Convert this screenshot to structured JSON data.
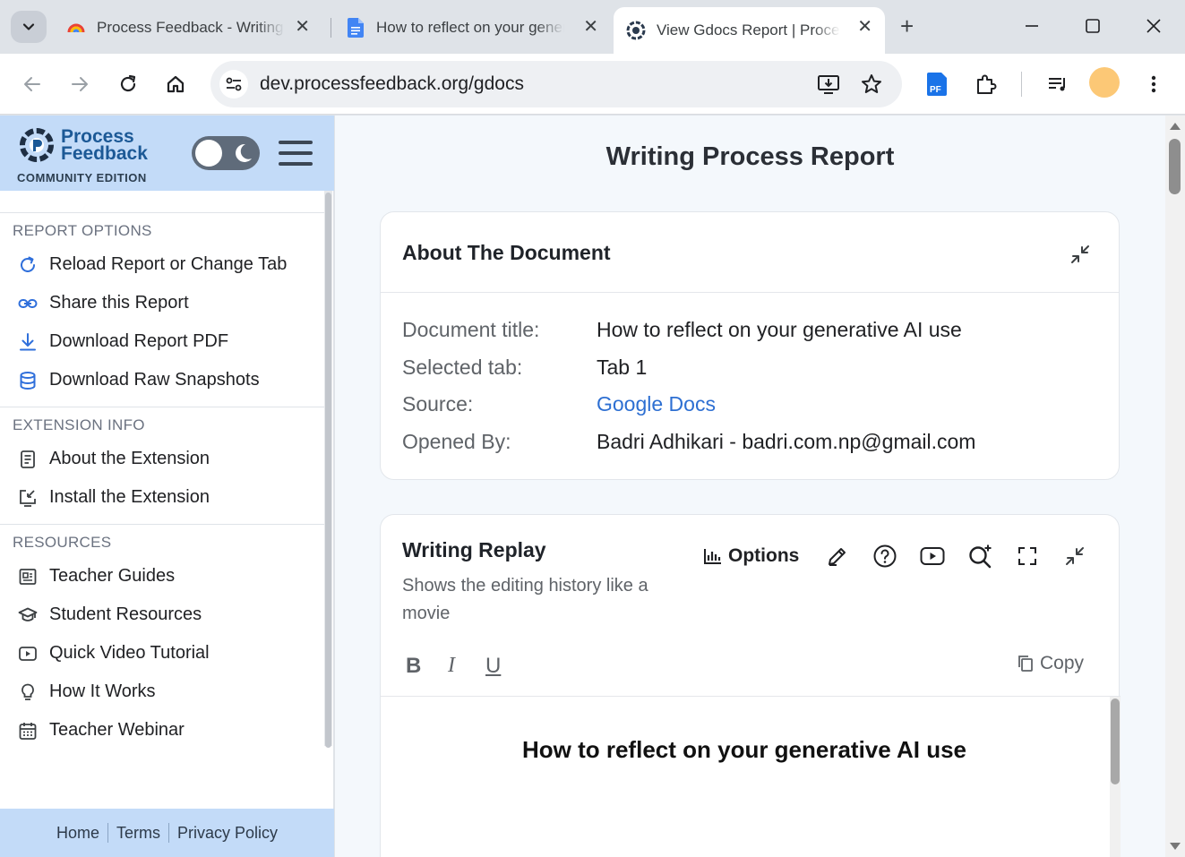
{
  "browser": {
    "tabs": [
      {
        "title": "Process Feedback - Writing",
        "favicon": "rainbow-icon"
      },
      {
        "title": "How to reflect on your generative AI use",
        "favicon": "google-docs-icon"
      },
      {
        "title": "View Gdocs Report | Process Feedback",
        "favicon": "process-feedback-icon"
      }
    ],
    "url": "dev.processfeedback.org/gdocs"
  },
  "sidebar": {
    "logo_line1": "Process",
    "logo_line2": "Feedback",
    "edition": "COMMUNITY EDITION",
    "sections": [
      {
        "title": "REPORT OPTIONS",
        "items": [
          {
            "label": "Reload Report or Change Tab",
            "icon": "reload-icon"
          },
          {
            "label": "Share this Report",
            "icon": "link-icon"
          },
          {
            "label": "Download Report PDF",
            "icon": "download-icon"
          },
          {
            "label": "Download Raw Snapshots",
            "icon": "database-icon"
          }
        ]
      },
      {
        "title": "EXTENSION INFO",
        "items": [
          {
            "label": "About the Extension",
            "icon": "document-icon"
          },
          {
            "label": "Install the Extension",
            "icon": "install-icon"
          }
        ]
      },
      {
        "title": "RESOURCES",
        "items": [
          {
            "label": "Teacher Guides",
            "icon": "guide-icon"
          },
          {
            "label": "Student Resources",
            "icon": "graduation-cap-icon"
          },
          {
            "label": "Quick Video Tutorial",
            "icon": "video-icon"
          },
          {
            "label": "How It Works",
            "icon": "lightbulb-icon"
          },
          {
            "label": "Teacher Webinar",
            "icon": "calendar-icon"
          }
        ]
      }
    ],
    "footer": {
      "home": "Home",
      "terms": "Terms",
      "privacy": "Privacy Policy"
    }
  },
  "main": {
    "page_title": "Writing Process Report",
    "about": {
      "title": "About The Document",
      "rows": [
        {
          "label": "Document title:",
          "value": "How to reflect on your generative AI use"
        },
        {
          "label": "Selected tab:",
          "value": "Tab 1"
        },
        {
          "label": "Source:",
          "value": "Google Docs"
        },
        {
          "label": "Opened By:",
          "value": "Badri Adhikari - badri.com.np@gmail.com"
        }
      ]
    },
    "replay": {
      "title": "Writing Replay",
      "subtitle": "Shows the editing history like a movie",
      "options_label": "Options",
      "bold": "B",
      "italic": "I",
      "underline": "U",
      "copy_label": "Copy",
      "doc_heading": "How to reflect on your generative AI use"
    }
  },
  "colors": {
    "accent": "#2d6fd2",
    "sidebar_header": "#c3dbf8",
    "brand": "#1c5996"
  }
}
